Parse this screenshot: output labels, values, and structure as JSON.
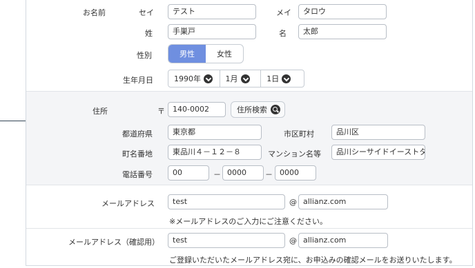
{
  "name": {
    "label": "お名前",
    "sei_label": "セイ",
    "sei_value": "テスト",
    "mei_label": "メイ",
    "mei_value": "タロウ",
    "sei_kanji_label": "姓",
    "sei_kanji_value": "手巣戸",
    "mei_kanji_label": "名",
    "mei_kanji_value": "太郎"
  },
  "gender": {
    "label": "性別",
    "options": [
      "男性",
      "女性"
    ],
    "selected": "男性",
    "accent_color": "#6f8fe0"
  },
  "birthdate": {
    "label": "生年月日",
    "year": "1990年",
    "month": "1月",
    "day": "1日"
  },
  "address": {
    "label": "住所",
    "postal_mark": "〒",
    "postal_value": "140-0002",
    "search_button": "住所検索",
    "prefecture_label": "都道府県",
    "prefecture_value": "東京都",
    "city_label": "市区町村",
    "city_value": "品川区",
    "street_label": "町名番地",
    "street_value": "東品川４－１２－８",
    "building_label": "マンション名等",
    "building_value": "品川シーサイドイーストタワ",
    "phone_label": "電話番号",
    "phone_1": "00",
    "phone_2": "0000",
    "phone_3": "0000",
    "phone_sep": "－"
  },
  "email": {
    "label": "メールアドレス",
    "local": "test",
    "at": "@",
    "domain": "allianz.com",
    "note": "※メールアドレスのご入力にご注意ください。"
  },
  "email_confirm": {
    "label": "メールアドレス（確認用）",
    "local": "test",
    "at": "@",
    "domain": "allianz.com",
    "note": "ご登録いただいたメールアドレス宛に、お申込みの確認メールをお送りいたします。"
  }
}
